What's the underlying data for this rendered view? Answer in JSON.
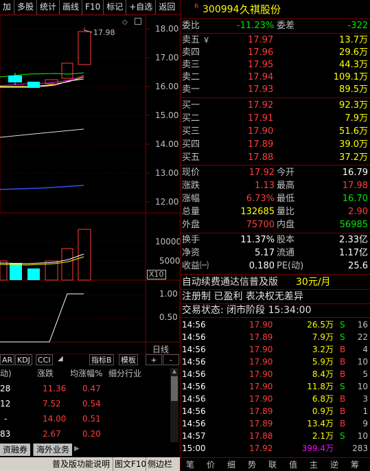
{
  "toolbar": {
    "items": [
      "加",
      "多股",
      "统计",
      "画线",
      "F10",
      "标记",
      "+自选",
      "返回"
    ]
  },
  "chart": {
    "price_ticks": [
      "18.00",
      "17.00",
      "16.00",
      "15.00",
      "14.00",
      "13.00",
      "12.00"
    ],
    "high_label": "17.98",
    "volume_ticks": [
      "10000",
      "5000"
    ],
    "volume_unit": "X10",
    "indicator_ticks": [
      "1.00",
      "0.50"
    ],
    "period_label": "日线",
    "indicator_tabs": [
      "AR",
      "KDJ",
      "CCI"
    ],
    "indicator_b": "指标B",
    "template": "模板",
    "plus": "+",
    "minus": "-",
    "colors": {
      "up": "#ff3c3c",
      "down": "#00ffff",
      "ma5": "#ffffff",
      "ma10": "#ffff00",
      "ma20": "#ff00ff",
      "ma60": "#00ff00"
    }
  },
  "sector_table": {
    "headers": [
      "动)",
      "涨跌",
      "均涨幅%",
      "细分行业"
    ],
    "rows": [
      {
        "c0": "28",
        "c1": "11.36",
        "c2": "0.47",
        "c3": ""
      },
      {
        "c0": "12",
        "c1": "7.52",
        "c2": "0.54",
        "c3": ""
      },
      {
        "c0": "-",
        "c1": "14.00",
        "c2": "0.51",
        "c3": ""
      },
      {
        "c0": "83",
        "c1": "2.67",
        "c2": "0.20",
        "c3": ""
      }
    ],
    "tabs": [
      "资融券",
      "海外业务"
    ]
  },
  "footer": {
    "help": "普及版功能说明",
    "graphic": "图文F10",
    "sidebar": "侧边栏 »"
  },
  "quote": {
    "marker": "R",
    "code": "300994",
    "name": "久祺股份",
    "weibi_label": "委比",
    "weibi": "-11.23%",
    "weicha_label": "委差",
    "weicha": "-322",
    "asks": [
      {
        "label": "卖五",
        "mark": "￥",
        "price": "17.97",
        "vol": "13.7万"
      },
      {
        "label": "卖四",
        "mark": "",
        "price": "17.96",
        "vol": "29.6万"
      },
      {
        "label": "卖三",
        "mark": "",
        "price": "17.95",
        "vol": "44.3万"
      },
      {
        "label": "卖二",
        "mark": "",
        "price": "17.94",
        "vol": "109.1万"
      },
      {
        "label": "卖一",
        "mark": "",
        "price": "17.93",
        "vol": "89.5万"
      }
    ],
    "bids": [
      {
        "label": "买一",
        "price": "17.92",
        "vol": "92.3万"
      },
      {
        "label": "买二",
        "price": "17.91",
        "vol": "7.9万"
      },
      {
        "label": "买三",
        "price": "17.90",
        "vol": "51.6万"
      },
      {
        "label": "买四",
        "price": "17.89",
        "vol": "39.0万"
      },
      {
        "label": "买五",
        "price": "17.88",
        "vol": "37.2万"
      }
    ],
    "stats": [
      {
        "l1": "现价",
        "v1": "17.92",
        "l2": "今开",
        "v2": "16.79",
        "c1": "red",
        "c2": "white"
      },
      {
        "l1": "涨跌",
        "v1": "1.13",
        "l2": "最高",
        "v2": "17.98",
        "c1": "red",
        "c2": "red"
      },
      {
        "l1": "涨幅",
        "v1": "6.73%",
        "l2": "最低",
        "v2": "16.70",
        "c1": "red",
        "c2": "green"
      },
      {
        "l1": "总量",
        "v1": "132685",
        "l2": "量比",
        "v2": "2.90",
        "c1": "yellow",
        "c2": "red"
      },
      {
        "l1": "外盘",
        "v1": "75700",
        "l2": "内盘",
        "v2": "56985",
        "c1": "red",
        "c2": "green"
      }
    ],
    "fund": [
      {
        "l1": "换手",
        "v1": "11.37%",
        "l2": "股本",
        "v2": "2.33亿"
      },
      {
        "l1": "净资",
        "v1": "5.17",
        "l2": "流通",
        "v2": "1.17亿"
      },
      {
        "l1": "收益㈠",
        "v1": "0.180",
        "l2": "PE(动)",
        "v2": "25.6"
      }
    ],
    "promo": "自动续费通达信普及版",
    "promo_price": "30元/月",
    "tags": "注册制 已盈利 表决权无差异",
    "status": "交易状态: 闭市阶段 15:34:00"
  },
  "ticks": [
    {
      "t": "14:56",
      "p": "17.90",
      "v": "26.5万",
      "s": "S",
      "n": "16"
    },
    {
      "t": "14:56",
      "p": "17.89",
      "v": "7.9万",
      "s": "S",
      "n": "22"
    },
    {
      "t": "14:56",
      "p": "17.90",
      "v": "3.2万",
      "s": "B",
      "n": "4"
    },
    {
      "t": "14:56",
      "p": "17.90",
      "v": "5.9万",
      "s": "B",
      "n": "10"
    },
    {
      "t": "14:56",
      "p": "17.90",
      "v": "8.4万",
      "s": "B",
      "n": "5"
    },
    {
      "t": "14:56",
      "p": "17.90",
      "v": "11.8万",
      "s": "S",
      "n": "10"
    },
    {
      "t": "14:56",
      "p": "17.90",
      "v": "6.8万",
      "s": "B",
      "n": "3"
    },
    {
      "t": "14:56",
      "p": "17.89",
      "v": "0.9万",
      "s": "B",
      "n": "1"
    },
    {
      "t": "14:56",
      "p": "17.89",
      "v": "13.4万",
      "s": "B",
      "n": "9"
    },
    {
      "t": "14:57",
      "p": "17.88",
      "v": "2.1万",
      "s": "S",
      "n": "10"
    },
    {
      "t": "15:00",
      "p": "17.92",
      "v": "399.4万",
      "s": "",
      "n": "283"
    }
  ],
  "bottom_tabs": [
    "笔",
    "价",
    "细",
    "势",
    "联",
    "值",
    "主",
    "逆",
    "筹"
  ]
}
